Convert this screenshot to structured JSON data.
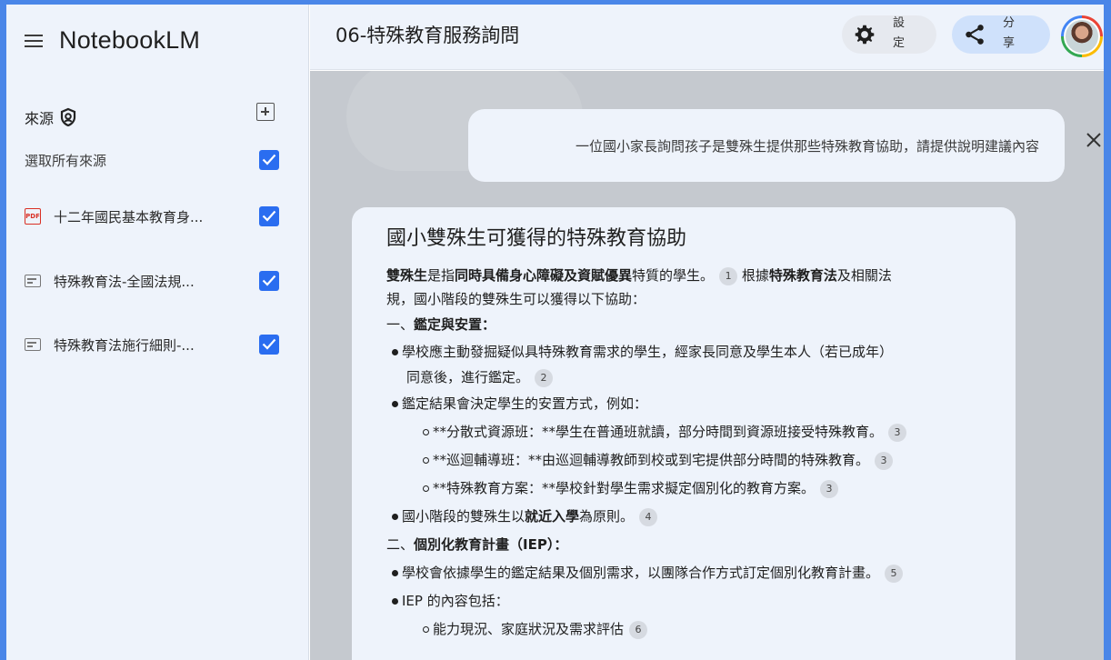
{
  "app": {
    "brand": "NotebookLM"
  },
  "sidebar": {
    "sources_label": "來源",
    "select_all_label": "選取所有來源",
    "items": [
      {
        "label": "十二年國民基本教育身...",
        "icon": "pdf-icon",
        "checked": true
      },
      {
        "label": "特殊教育法-全國法規...",
        "icon": "document-icon",
        "checked": true
      },
      {
        "label": "特殊教育法施行細則-...",
        "icon": "document-icon",
        "checked": true
      }
    ],
    "pdf_badge": "PDF"
  },
  "header": {
    "notebook_title": "06-特殊教育服務詢問",
    "settings_label": "設定",
    "share_label": "分享"
  },
  "query": {
    "text": "一位國小家長詢問孩子是雙殊生提供那些特殊教育協助，請提供說明建議內容"
  },
  "answer": {
    "title": "國小雙殊生可獲得的特殊教育協助",
    "intro": {
      "p1": "雙殊生",
      "p2": "是指",
      "p3": "同時具備身心障礙及資賦優異",
      "p4": "特質的學生。",
      "c1": "1",
      "p5": " 根據",
      "p6": "特殊教育法",
      "p7": "及相關法",
      "line2": "規，國小階段的雙殊生可以獲得以下協助："
    },
    "sec1": {
      "num": "一、",
      "title": "鑑定與安置："
    },
    "b1": {
      "line1": "學校應主動發掘疑似具特殊教育需求的學生，經家長同意及學生本人（若已成年）",
      "line2": "同意後，進行鑑定。",
      "cite": "2"
    },
    "b2": {
      "text": "鑑定結果會決定學生的安置方式，例如："
    },
    "sub": [
      {
        "text": "**分散式資源班：**學生在普通班就讀，部分時間到資源班接受特殊教育。",
        "cite": "3"
      },
      {
        "text": "**巡迴輔導班：**由巡迴輔導教師到校或到宅提供部分時間的特殊教育。",
        "cite": "3"
      },
      {
        "text": "**特殊教育方案：**學校針對學生需求擬定個別化的教育方案。",
        "cite": "3"
      }
    ],
    "b3": {
      "p1": "國小階段的雙殊生以",
      "p2": "就近入學",
      "p3": "為原則。",
      "cite": "4"
    },
    "sec2": {
      "num": "二、",
      "title": "個別化教育計畫（IEP）："
    },
    "b4": {
      "text": "學校會依據學生的鑑定結果及個別需求，以團隊合作方式訂定個別化教育計畫。",
      "cite": "5"
    },
    "b5": {
      "text": "IEP 的內容包括："
    },
    "sub2": [
      {
        "text": "能力現況、家庭狀況及需求評估",
        "cite": "6"
      }
    ]
  },
  "colors": {
    "accent": "#2a6df0",
    "frame": "#4a86e8",
    "panel": "#eef3fb",
    "backdrop": "#c5c9cf"
  }
}
